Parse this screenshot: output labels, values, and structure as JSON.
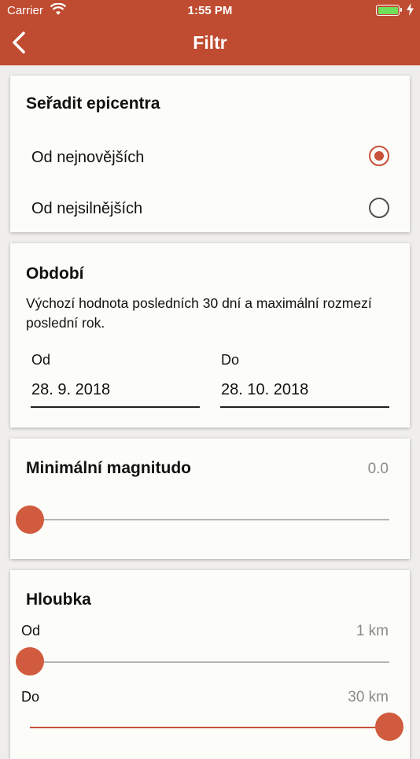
{
  "status_bar": {
    "carrier": "Carrier",
    "time": "1:55 PM"
  },
  "nav": {
    "title": "Filtr",
    "back_icon": "chevron-left-icon"
  },
  "colors": {
    "accent": "#bf4b31",
    "control": "#c9503a"
  },
  "sort": {
    "title": "Seřadit epicentra",
    "options": [
      {
        "label": "Od nejnovějších",
        "selected": true
      },
      {
        "label": "Od nejsilnějších",
        "selected": false
      }
    ]
  },
  "period": {
    "title": "Období",
    "description": "Výchozí hodnota posledních 30 dní a maximální rozmezí poslední rok.",
    "from_label": "Od",
    "from_value": "28. 9. 2018",
    "to_label": "Do",
    "to_value": "28. 10. 2018"
  },
  "magnitude": {
    "title": "Minimální magnitudo",
    "value_text": "0.0",
    "slider_fraction": 0.0
  },
  "depth": {
    "title": "Hloubka",
    "from_label": "Od",
    "from_value_text": "1 km",
    "from_slider_fraction": 0.0,
    "to_label": "Do",
    "to_value_text": "30 km",
    "to_slider_fraction": 1.0
  }
}
